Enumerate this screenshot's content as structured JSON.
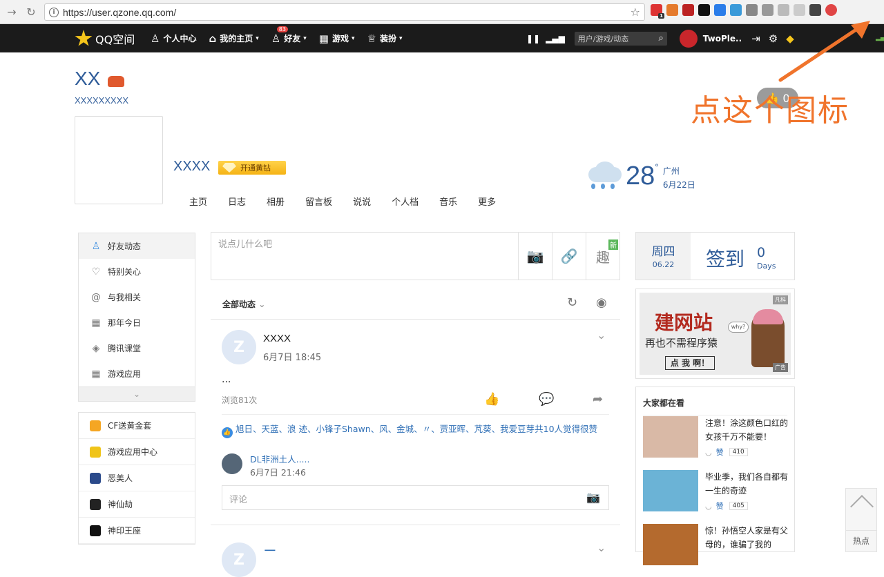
{
  "browser": {
    "url": "https://user.qzone.qq.com/",
    "extensions": [
      {
        "name": "calendar-ext-icon",
        "color": "#d33",
        "label": "",
        "count": "1"
      },
      {
        "name": "orange-ext-icon",
        "color": "#e57a2c",
        "label": "",
        "count": ""
      },
      {
        "name": "red-book-ext-icon",
        "color": "#b22",
        "label": "",
        "count": ""
      },
      {
        "name": "circle-ext-icon",
        "color": "#111",
        "label": "",
        "count": ""
      },
      {
        "name": "bolt-ext-icon",
        "color": "#2b7de9",
        "label": "",
        "count": ""
      },
      {
        "name": "send-ext-icon",
        "color": "#3a9ad9",
        "label": "",
        "count": ""
      },
      {
        "name": "info-ext-icon",
        "color": "#888",
        "label": "",
        "count": ""
      },
      {
        "name": "tool-ext-icon",
        "color": "#999",
        "label": "",
        "count": ""
      },
      {
        "name": "shield-ext-icon",
        "color": "#bbb",
        "label": "",
        "count": ""
      },
      {
        "name": "puzzle-ext-icon",
        "color": "#ccc",
        "label": "",
        "count": ""
      },
      {
        "name": "glasses-ext-icon",
        "color": "#444",
        "label": "",
        "count": ""
      },
      {
        "name": "qzone-ext-icon",
        "color": "#e04545",
        "label": "",
        "count": ""
      }
    ]
  },
  "topbar": {
    "logo": "QQ空间",
    "menu": [
      {
        "label": "个人中心",
        "icon": "user-icon",
        "glyph": "♙",
        "badge": "",
        "dropdown": ""
      },
      {
        "label": "我的主页",
        "icon": "home-icon",
        "glyph": "⌂",
        "badge": "",
        "dropdown": "▾"
      },
      {
        "label": "好友",
        "icon": "friends-icon",
        "glyph": "♙",
        "badge": "83",
        "dropdown": "▾"
      },
      {
        "label": "游戏",
        "icon": "games-grid-icon",
        "glyph": "▦",
        "badge": "",
        "dropdown": "▾"
      },
      {
        "label": "装扮",
        "icon": "shirt-icon",
        "glyph": "♕",
        "badge": "",
        "dropdown": "▾"
      }
    ],
    "search_placeholder": "用户/游戏/动态",
    "username": "TwoPle.."
  },
  "profile": {
    "name": "XX",
    "subtitle": "XXXXXXXXX",
    "display_name": "XXXX",
    "vip_button": "开通黄钻",
    "tabs": [
      "主页",
      "日志",
      "相册",
      "留言板",
      "说说",
      "个人档",
      "音乐",
      "更多"
    ],
    "like_count": "0"
  },
  "weather": {
    "temp": "28",
    "unit": "°",
    "city": "广州",
    "date": "6月22日"
  },
  "annotation": {
    "text": "点这个图标",
    "color": "#f0742c"
  },
  "left_nav": {
    "items": [
      {
        "label": "好友动态",
        "glyph": "♙",
        "icon": "friends-feed-icon",
        "active": true
      },
      {
        "label": "特别关心",
        "glyph": "♡",
        "icon": "heart-icon",
        "active": false
      },
      {
        "label": "与我相关",
        "glyph": "@",
        "icon": "at-icon",
        "active": false
      },
      {
        "label": "那年今日",
        "glyph": "▦",
        "icon": "calendar-icon",
        "active": false
      },
      {
        "label": "腾讯课堂",
        "glyph": "◈",
        "icon": "graduation-icon",
        "active": false
      },
      {
        "label": "游戏应用",
        "glyph": "▦",
        "icon": "apps-grid-icon",
        "active": false
      }
    ],
    "more": "⌄"
  },
  "left_apps": [
    {
      "label": "CF送黄金套",
      "color": "#f5a623"
    },
    {
      "label": "游戏应用中心",
      "color": "#f0c419"
    },
    {
      "label": "恶美人",
      "color": "#2b4a8b"
    },
    {
      "label": "神仙劫",
      "color": "#222"
    },
    {
      "label": "神印王座",
      "color": "#111"
    }
  ],
  "composer": {
    "placeholder": "说点儿什么吧",
    "new_tag": "新"
  },
  "feed": {
    "filter_label": "全部动态",
    "post": {
      "author": "XXXX",
      "time": "6月7日 18:45",
      "body": "...",
      "views": "浏览81次",
      "likes_text": "旭日、天蓝、浪 迹、小锋子Shawn、风、金城、〃、贾亚晖、芃葵、我爱豆芽共10人觉得很赞",
      "comment": {
        "author": "DL非洲土人.....",
        "time": "6月7日 21:46"
      },
      "comment_placeholder": "评论"
    },
    "next_post_author": "ㄧ"
  },
  "signin": {
    "weekday": "周四",
    "date": "06.22",
    "label": "签到",
    "count": "0",
    "unit": "Days"
  },
  "ad": {
    "headline": "建网站",
    "sub": "再也不需程序猿",
    "cta": "点 我 啊！",
    "why": "why?",
    "brand": "凡科",
    "tag": "广告"
  },
  "hot": {
    "title": "大家都在看",
    "items": [
      {
        "text": "注意！涂这颜色口红的女孩千万不能要！",
        "like": "赞",
        "count": "410",
        "color": "#d9b9a6"
      },
      {
        "text": "毕业季，我们各自都有一生的奇迹",
        "like": "赞",
        "count": "405",
        "color": "#6bb3d6"
      },
      {
        "text": "惊！孙悟空人家是有父母的，谁骗了我的",
        "like": "赞",
        "count": "",
        "color": "#b46a2e"
      }
    ]
  },
  "backtop": {
    "label": "热点"
  }
}
